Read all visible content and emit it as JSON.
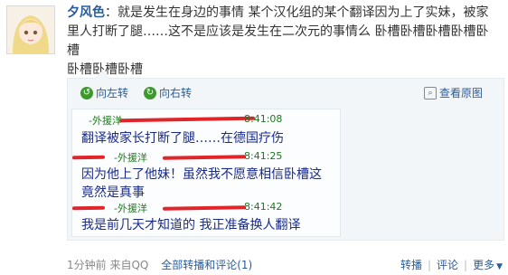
{
  "post": {
    "author": "夕风色",
    "author_suffix": "：",
    "text_line1": "就是发生在身边的事情 某个汉化组的某个翻译因为上了实妹，被家",
    "text_line2": "里人打断了腿……这不是应该是发生在二次元的事情么 卧槽卧槽卧槽卧槽卧槽",
    "text_line3": "卧槽卧槽卧槽"
  },
  "toolbar": {
    "rotate_left": "向左转",
    "rotate_right": "向右转",
    "view_original": "查看原图"
  },
  "chat": {
    "messages": [
      {
        "sender": "-外援洋",
        "time": "8:41:08",
        "text": "翻译被家长打断了腿……在德国疗伤"
      },
      {
        "sender": "-外援洋",
        "time": "8:41:25",
        "text_line1": "因为他上了他妹！虽然我不愿意相信卧槽这",
        "text_line2": "竟然是真事"
      },
      {
        "sender": "-外援洋",
        "time": "8:41:42",
        "text": "我是前几天才知道的  我正准备换人翻译"
      }
    ]
  },
  "footer": {
    "time": "1分钟前",
    "source": "来自QQ",
    "all_label": "全部转播和评论(1)",
    "repost": "转播",
    "comment": "评论",
    "more": "更多"
  }
}
